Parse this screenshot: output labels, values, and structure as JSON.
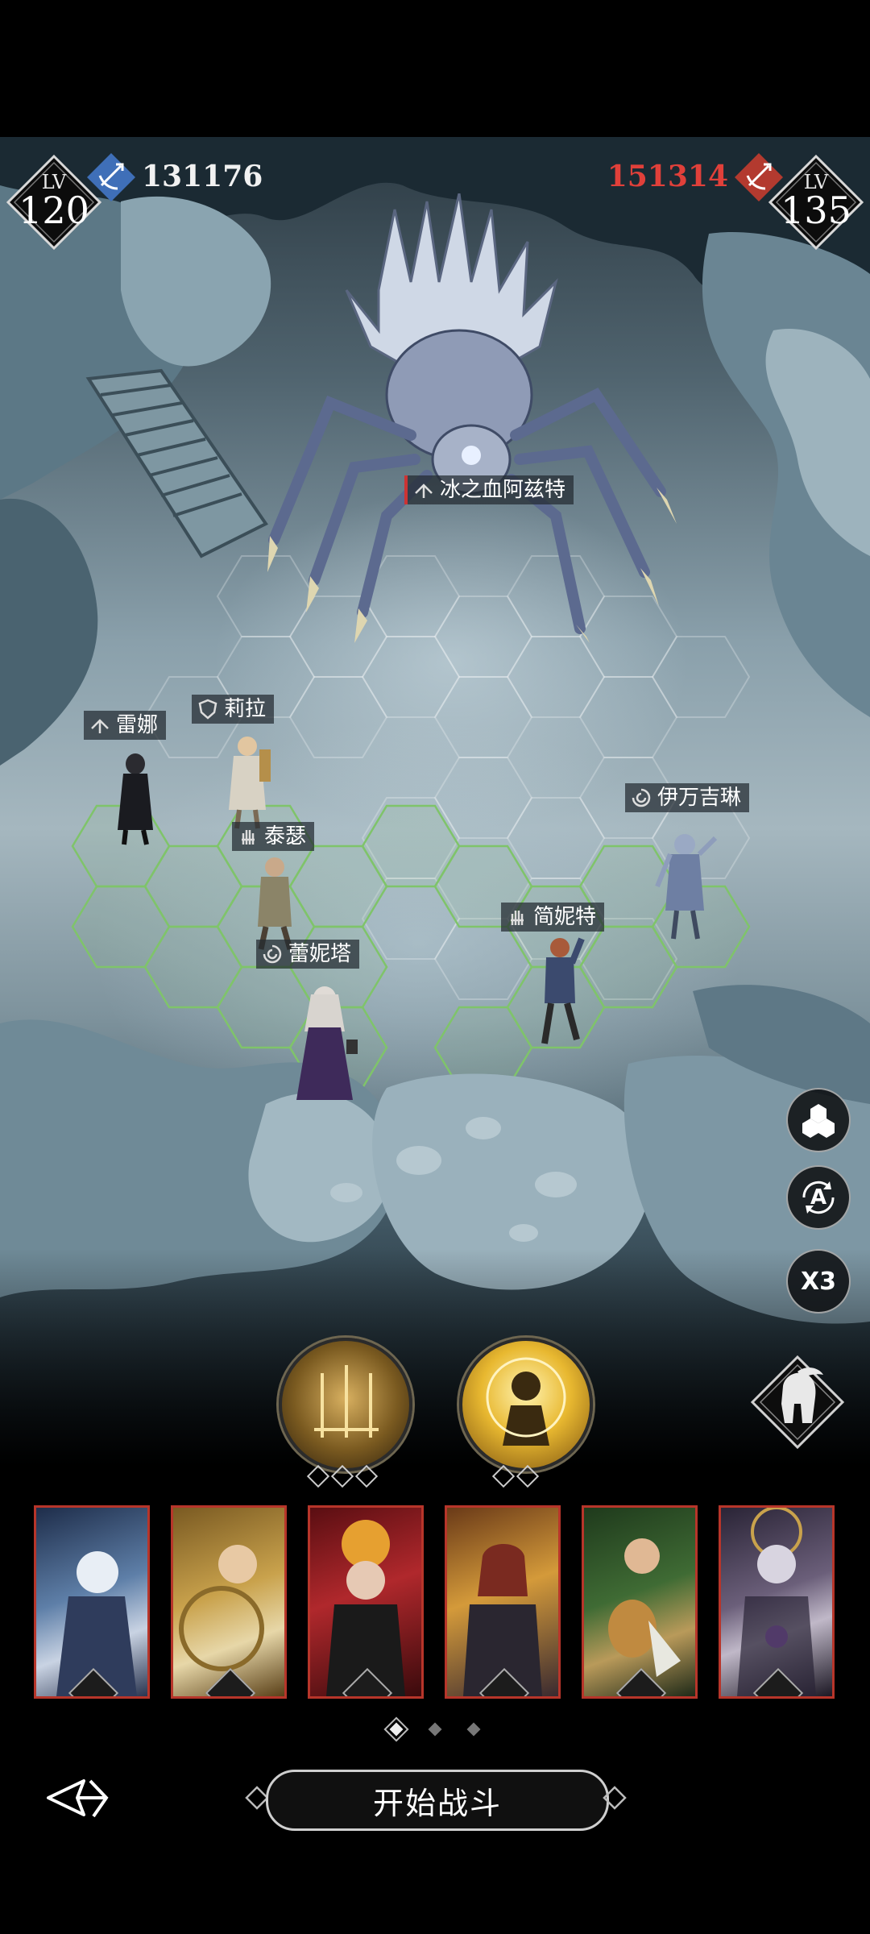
{
  "ally": {
    "level_label": "LV",
    "level": "120",
    "power": "131176",
    "color": "#3f6fb8"
  },
  "enemy": {
    "level_label": "LV",
    "level": "135",
    "power": "151314",
    "color": "#b33a2f"
  },
  "boss": {
    "name": "冰之血阿兹特",
    "class_icon": "marksman-icon"
  },
  "units": [
    {
      "name": "雷娜",
      "class_icon": "marksman-icon"
    },
    {
      "name": "莉拉",
      "class_icon": "shield-icon"
    },
    {
      "name": "泰瑟",
      "class_icon": "hand-icon"
    },
    {
      "name": "蕾妮塔",
      "class_icon": "swirl-icon"
    },
    {
      "name": "简妮特",
      "class_icon": "hand-icon"
    },
    {
      "name": "伊万吉琳",
      "class_icon": "swirl-icon"
    }
  ],
  "side_buttons": [
    {
      "name": "formation-button",
      "icon": "hexagon-cluster-icon"
    },
    {
      "name": "auto-button",
      "text": "A"
    },
    {
      "name": "speed-button",
      "text": "X3"
    }
  ],
  "skills": [
    {
      "name": "skill-1",
      "charges": 3
    },
    {
      "name": "skill-2",
      "charges": 2
    }
  ],
  "roster": [
    {
      "class_icon": "swirl-icon",
      "palette": "#5e7fa8"
    },
    {
      "class_icon": "shield-icon",
      "palette": "#b08a3a"
    },
    {
      "class_icon": "marksman-icon",
      "palette": "#8a1f22"
    },
    {
      "class_icon": "hand-icon",
      "palette": "#b27a2a"
    },
    {
      "class_icon": "hand-icon",
      "palette": "#3f6b34"
    },
    {
      "class_icon": "swirl-icon",
      "palette": "#6b5f7a"
    }
  ],
  "pager": {
    "pages": 3,
    "current": 1
  },
  "start_button": "开始战斗"
}
